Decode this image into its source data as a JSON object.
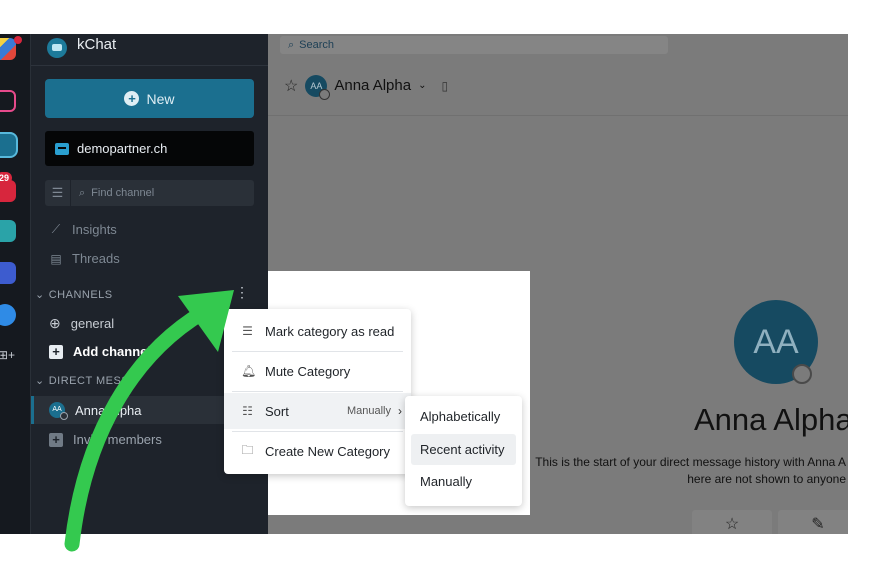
{
  "colors": {
    "accent": "#1b6f8f",
    "sidebar_bg": "#1e232b",
    "arrow_green": "#34c94f",
    "badge_red": "#d7263d"
  },
  "rail": {
    "badge_count": "29",
    "grid_label": "⊞+"
  },
  "sidebar": {
    "app_name": "kChat",
    "new_button_label": "New",
    "workspace_name": "demopartner.ch",
    "find_channel_placeholder": "Find channel",
    "nav": [
      {
        "label": "Insights",
        "icon": "chart-line-icon"
      },
      {
        "label": "Threads",
        "icon": "threads-icon"
      }
    ],
    "channels_header": "CHANNELS",
    "channels": [
      {
        "label": "general",
        "icon": "globe-icon"
      },
      {
        "label": "Add channels",
        "icon": "plus-box-icon"
      }
    ],
    "direct_messages_header": "DIRECT MESSA",
    "direct_messages": [
      {
        "label": "Anna Alpha",
        "initials": "AA"
      }
    ],
    "invite_label": "Invite members"
  },
  "main": {
    "search_placeholder": "Search",
    "channel_title": "Anna Alpha",
    "avatar_initials": "AA",
    "big_name": "Anna Alpha",
    "intro_line1": "This is the start of your direct message history with Anna A",
    "intro_line2": "here are not shown to anyone"
  },
  "category_menu": {
    "items": [
      {
        "label": "Mark category as read",
        "icon": "mark-read-icon"
      },
      {
        "label": "Mute Category",
        "icon": "bell-icon"
      },
      {
        "label": "Sort",
        "icon": "list-icon",
        "value": "Manually"
      },
      {
        "label": "Create New Category",
        "icon": "folder-plus-icon"
      }
    ]
  },
  "sort_menu": {
    "items": [
      "Alphabetically",
      "Recent activity",
      "Manually"
    ],
    "highlighted": "Recent activity"
  }
}
